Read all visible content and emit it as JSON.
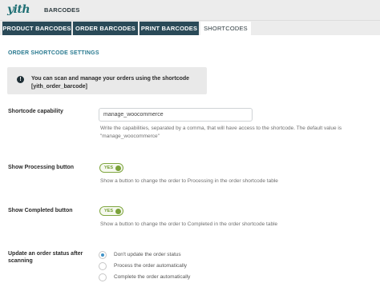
{
  "header": {
    "logo_text": "yith",
    "title": "BARCODES"
  },
  "tabs": [
    {
      "label": "PRODUCT BARCODES",
      "active": false
    },
    {
      "label": "ORDER BARCODES",
      "active": false
    },
    {
      "label": "PRINT BARCODES",
      "active": false
    },
    {
      "label": "SHORTCODES",
      "active": true
    }
  ],
  "section": {
    "title": "ORDER SHORTCODE SETTINGS"
  },
  "notice": {
    "icon": "info-icon",
    "line1": "You can scan and manage your orders using the shortcode",
    "line2": "[yith_order_barcode]"
  },
  "shortcode_capability": {
    "label": "Shortcode capability",
    "value": "manage_woocommerce",
    "description_line1": "Write the capabilities, separated by a comma, that will have access to the shortcode. The default value is",
    "description_line2": "\"manage_woocommerce\""
  },
  "show_processing": {
    "label": "Show Processing button",
    "toggle_text": "YES",
    "enabled": true,
    "description": "Show a button to change the order to Processing in the order shortcode table"
  },
  "show_completed": {
    "label": "Show Completed button",
    "toggle_text": "YES",
    "enabled": true,
    "description": "Show a button to change the order to Completed in the order shortcode table"
  },
  "update_status": {
    "label_line1": "Update an order status after",
    "label_line2": "scanning",
    "options": [
      {
        "label": "Don't update the order status",
        "checked": true
      },
      {
        "label": "Process the order automatically",
        "checked": false
      },
      {
        "label": "Complete the order automatically",
        "checked": false
      }
    ]
  },
  "colors": {
    "tab_bg": "#2a4a58",
    "accent_blue": "#2a7a90",
    "toggle_green": "#7ba23b",
    "radio_blue": "#3f92c7"
  }
}
